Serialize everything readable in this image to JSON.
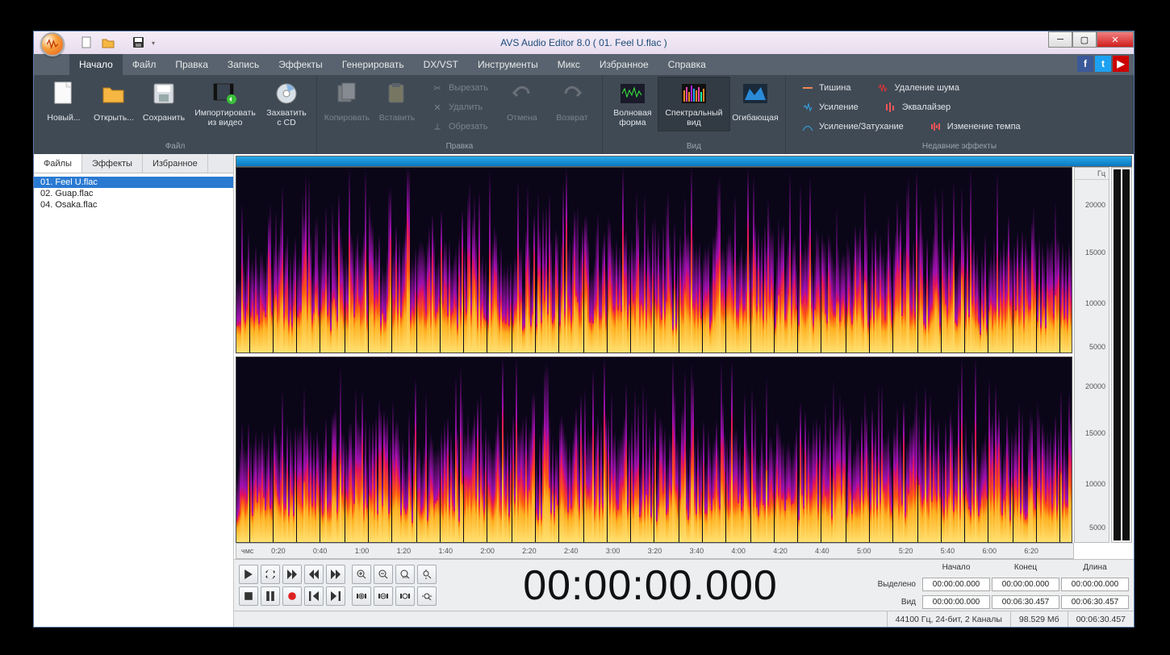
{
  "title": "AVS Audio Editor 8.0  ( 01. Feel U.flac )",
  "menu": {
    "items": [
      "Начало",
      "Файл",
      "Правка",
      "Запись",
      "Эффекты",
      "Генерировать",
      "DX/VST",
      "Инструменты",
      "Микс",
      "Избранное",
      "Справка"
    ],
    "active": 0
  },
  "ribbon": {
    "groups": {
      "file": {
        "label": "Файл",
        "new": "Новый...",
        "open": "Открыть...",
        "save": "Сохранить",
        "import_video": "Импортировать из видео",
        "grab_cd": "Захватить с CD"
      },
      "edit": {
        "label": "Правка",
        "copy": "Копировать",
        "paste": "Вставить",
        "cut": "Вырезать",
        "delete": "Удалить",
        "trim": "Обрезать",
        "undo": "Отмена",
        "redo": "Возврат"
      },
      "view": {
        "label": "Вид",
        "waveform": "Волновая форма",
        "spectral": "Спектральный вид",
        "envelope": "Огибающая"
      },
      "recent": {
        "label": "Недавние эффекты",
        "silence": "Тишина",
        "denoise": "Удаление шума",
        "amplify": "Усиление",
        "equalizer": "Эквалайзер",
        "fade": "Усиление/Затухание",
        "tempo": "Изменение темпа"
      }
    }
  },
  "sidetabs": {
    "items": [
      "Файлы",
      "Эффекты",
      "Избранное"
    ],
    "active": 0
  },
  "files": {
    "items": [
      "01. Feel U.flac",
      "02. Guap.flac",
      "04. Osaka.flac"
    ],
    "selected": 0
  },
  "freq": {
    "unit": "Гц",
    "ticks": [
      "20000",
      "15000",
      "10000",
      "5000"
    ]
  },
  "time": {
    "unit": "чмс",
    "ticks": [
      "0:20",
      "0:40",
      "1:00",
      "1:20",
      "1:40",
      "2:00",
      "2:20",
      "2:40",
      "3:00",
      "3:20",
      "3:40",
      "4:00",
      "4:20",
      "4:40",
      "5:00",
      "5:20",
      "5:40",
      "6:00",
      "6:20"
    ]
  },
  "bigtime": "00:00:00.000",
  "timeboxes": {
    "headers": [
      "Начало",
      "Конец",
      "Длина"
    ],
    "rows": [
      {
        "label": "Выделено",
        "values": [
          "00:00:00.000",
          "00:00:00.000",
          "00:00:00.000"
        ]
      },
      {
        "label": "Вид",
        "values": [
          "00:00:00.000",
          "00:06:30.457",
          "00:06:30.457"
        ]
      }
    ]
  },
  "status": {
    "format": "44100 Гц, 24-бит, 2 Каналы",
    "size": "98.529 Мб",
    "length": "00:06:30.457"
  }
}
